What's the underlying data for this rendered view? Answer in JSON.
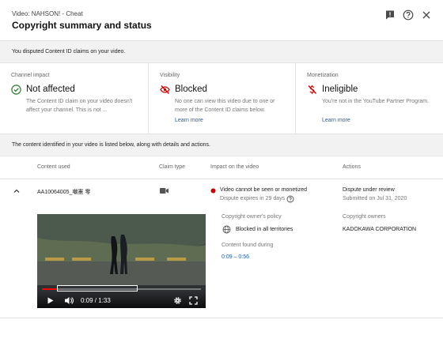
{
  "header": {
    "subtitle": "Video: NAHSON! - Cheat",
    "title": "Copyright summary and status",
    "icons": [
      "feedback-icon",
      "help-icon",
      "close-icon"
    ]
  },
  "notice": "You disputed Content ID claims on your video.",
  "status_columns": [
    {
      "label": "Channel impact",
      "icon": "check-circle-icon",
      "status": "Not affected",
      "description": "The Content ID claim on your video doesn't affect your channel. This is not ...",
      "link": ""
    },
    {
      "label": "Visibility",
      "icon": "eye-off-icon",
      "status": "Blocked",
      "description": "No one can view this video due to one or more of the Content ID claims below.",
      "link": "Learn more"
    },
    {
      "label": "Monetization",
      "icon": "no-money-icon",
      "status": "Ineligible",
      "description": "You're not in the YouTube Partner Program.",
      "link": "Learn more"
    }
  ],
  "info": "The content identified in your video is listed below, along with details and actions.",
  "table": {
    "headers": [
      "Content used",
      "Claim type",
      "Impact on the video",
      "Actions"
    ],
    "row": {
      "content_id": "AA10064005_嘲憲 零",
      "impact": "Video cannot be seen or monetized",
      "dispute_expiry": "Dispute expires in 29 days",
      "action": "Dispute under review",
      "action_date": "Submitted on Jul 31, 2020"
    },
    "details": {
      "policy_label": "Copyright owner's policy",
      "policy_value": "Blocked in all territories",
      "owner_label": "Copyright owners",
      "owner_value": "KADOKAWA CORPORATION",
      "found_label": "Content found during",
      "found_value": "0:09 – 0:56"
    }
  },
  "player": {
    "time": "0:09 / 1:33",
    "progress": 0.097,
    "segment_start": 0.097,
    "segment_end": 0.602
  },
  "colors": {
    "accent_red": "#cc0000",
    "link_blue": "#1a5fb4",
    "check_green": "#2e7d32"
  }
}
